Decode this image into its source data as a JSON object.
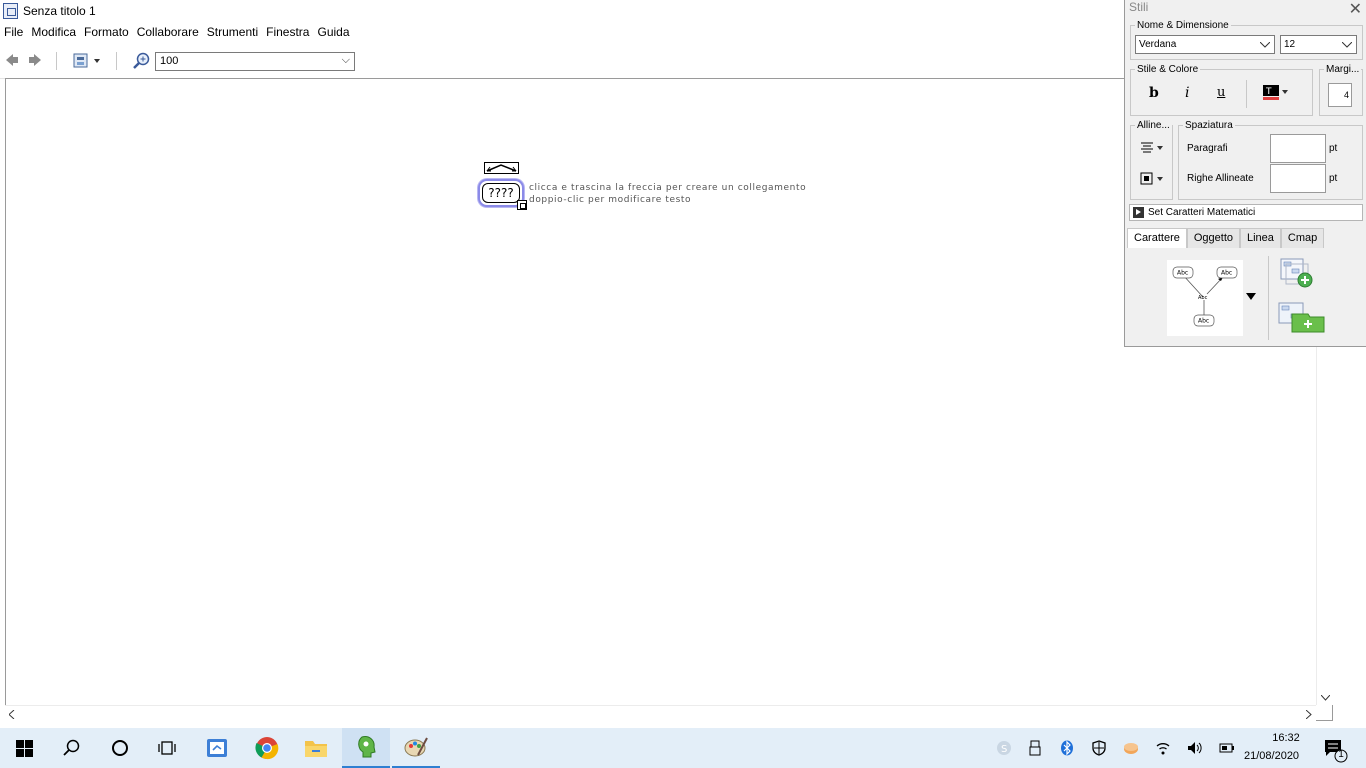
{
  "window": {
    "title": "Senza titolo 1"
  },
  "menu": [
    "File",
    "Modifica",
    "Formato",
    "Collaborare",
    "Strumenti",
    "Finestra",
    "Guida"
  ],
  "toolbar": {
    "zoom_value": "100"
  },
  "canvas": {
    "concept_label": "????",
    "hint_line1": "clicca e trascina la freccia per creare un collegamento",
    "hint_line2": "doppio-clic per modificare testo"
  },
  "styles_panel": {
    "title": "Stili",
    "font_group_label": "Nome & Dimensione",
    "font_name": "Verdana",
    "font_size": "12",
    "style_color_label": "Stile & Colore",
    "bold_label": "b",
    "italic_label": "i",
    "underline_label": "u",
    "margin_label": "Margi...",
    "margin_value": "4",
    "align_label": "Alline...",
    "spacing_label": "Spaziatura",
    "paragraphs_label": "Paragrafi",
    "lines_label": "Righe Allineate",
    "unit_pt": "pt",
    "math_label": "Set Caratteri Matematici",
    "tabs": [
      "Carattere",
      "Oggetto",
      "Linea",
      "Cmap"
    ],
    "active_tab": "Carattere",
    "preview_label": "Abc"
  },
  "taskbar": {
    "time": "16:32",
    "date": "21/08/2020",
    "notification_count": "1"
  },
  "colors": {
    "accent": "#2f7fd1",
    "node_outline": "#8b8ae8",
    "taskbar_bg": "#e3eef8"
  }
}
